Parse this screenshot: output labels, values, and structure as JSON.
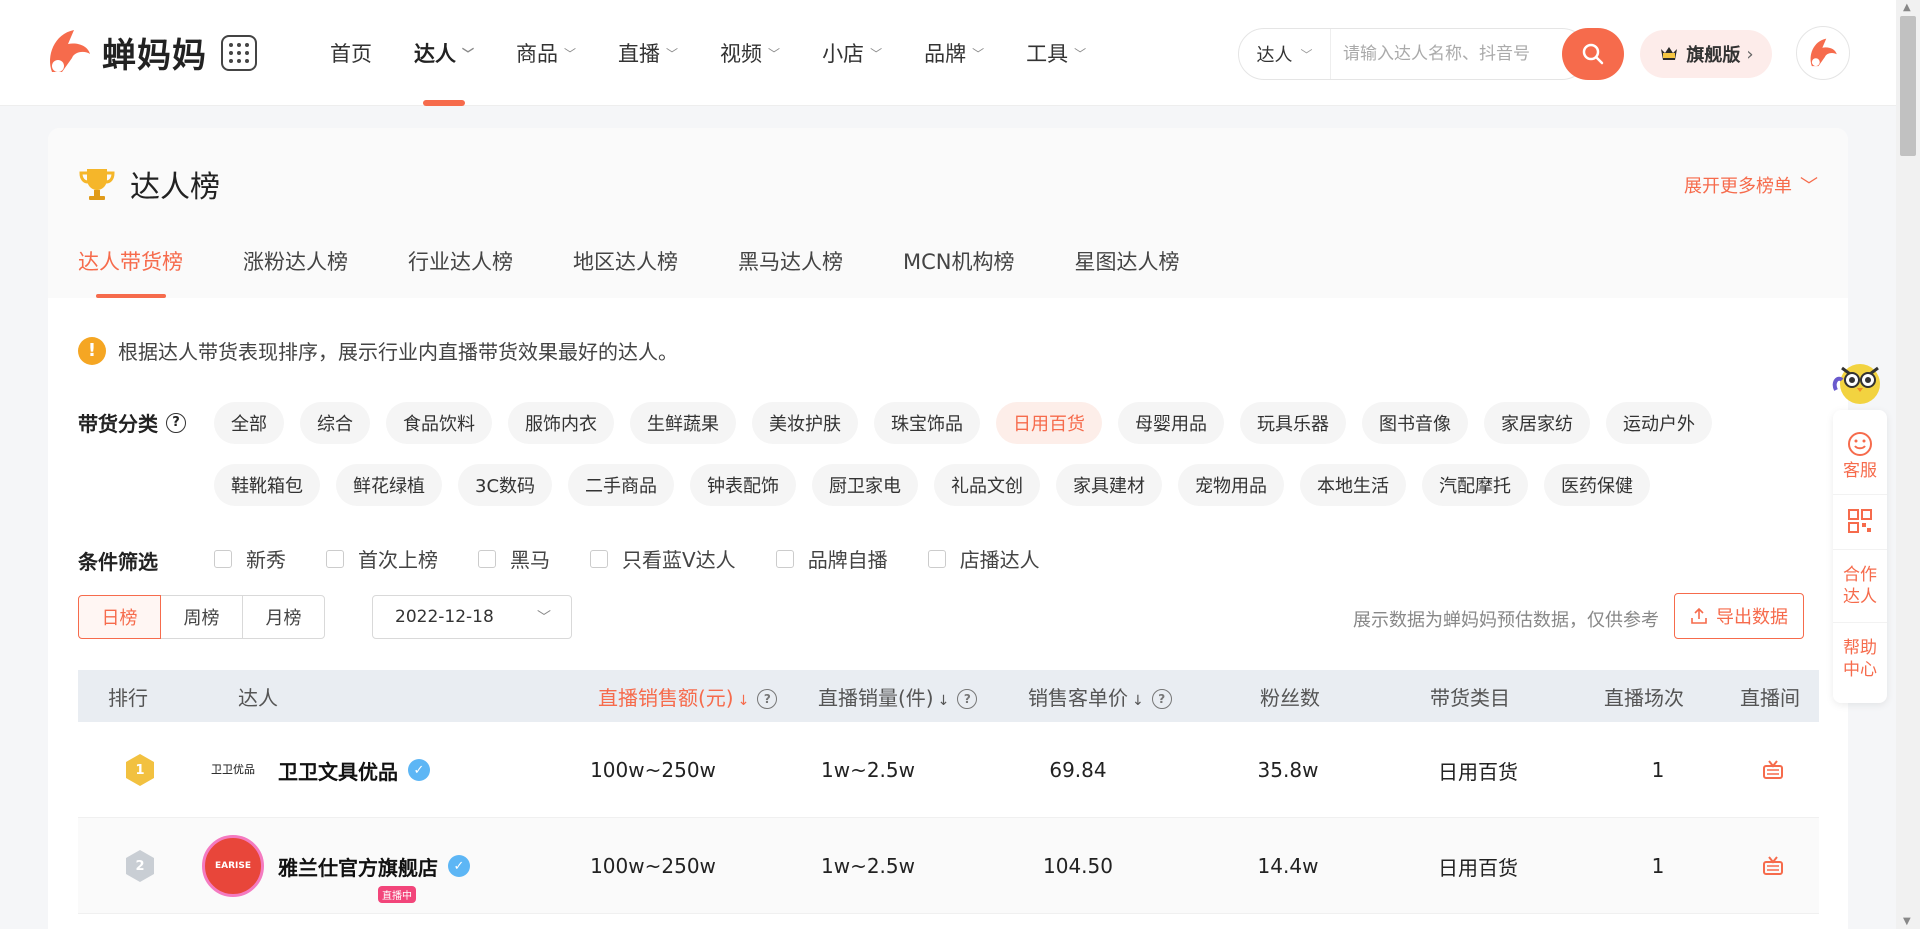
{
  "header": {
    "logo_text": "蝉妈妈",
    "nav": [
      {
        "label": "首页",
        "has_menu": false
      },
      {
        "label": "达人",
        "has_menu": true,
        "active": true
      },
      {
        "label": "商品",
        "has_menu": true
      },
      {
        "label": "直播",
        "has_menu": true
      },
      {
        "label": "视频",
        "has_menu": true
      },
      {
        "label": "小店",
        "has_menu": true
      },
      {
        "label": "品牌",
        "has_menu": true
      },
      {
        "label": "工具",
        "has_menu": true
      }
    ],
    "search": {
      "type": "达人",
      "placeholder": "请输入达人名称、抖音号"
    },
    "vip_label": "旗舰版"
  },
  "board": {
    "title": "达人榜",
    "expand_more": "展开更多榜单",
    "tabs": [
      "达人带货榜",
      "涨粉达人榜",
      "行业达人榜",
      "地区达人榜",
      "黑马达人榜",
      "MCN机构榜",
      "星图达人榜"
    ],
    "active_tab": 0,
    "notice": "根据达人带货表现排序，展示行业内直播带货效果最好的达人。",
    "category_label": "带货分类",
    "categories": [
      "全部",
      "综合",
      "食品饮料",
      "服饰内衣",
      "生鲜蔬果",
      "美妆护肤",
      "珠宝饰品",
      "日用百货",
      "母婴用品",
      "玩具乐器",
      "图书音像",
      "家居家纺",
      "运动户外",
      "鞋靴箱包",
      "鲜花绿植",
      "3C数码",
      "二手商品",
      "钟表配饰",
      "厨卫家电",
      "礼品文创",
      "家具建材",
      "宠物用品",
      "本地生活",
      "汽配摩托",
      "医药保健"
    ],
    "active_category": 7,
    "filter_label": "条件筛选",
    "filters": [
      "新秀",
      "首次上榜",
      "黑马",
      "只看蓝V达人",
      "品牌自播",
      "店播达人"
    ],
    "ranges": [
      "日榜",
      "周榜",
      "月榜"
    ],
    "active_range": 0,
    "date": "2022-12-18",
    "data_note": "展示数据为蝉妈妈预估数据，仅供参考",
    "export_label": "导出数据"
  },
  "table": {
    "headers": {
      "rank": "排行",
      "talent": "达人",
      "live_sales": "直播销售额(元)",
      "live_volume": "直播销量(件)",
      "avg_price": "销售客单价",
      "fans": "粉丝数",
      "category": "带货类目",
      "sessions": "直播场次",
      "room": "直播间"
    },
    "rows": [
      {
        "rank": "1",
        "name": "卫卫文具优品",
        "avatar_text": "卫卫优品",
        "live": false,
        "sales": "100w~250w",
        "volume": "1w~2.5w",
        "price": "69.84",
        "fans": "35.8w",
        "category": "日用百货",
        "sessions": "1"
      },
      {
        "rank": "2",
        "name": "雅兰仕官方旗舰店",
        "avatar_text": "EARISE",
        "live": true,
        "live_label": "直播中",
        "sales": "100w~250w",
        "volume": "1w~2.5w",
        "price": "104.50",
        "fans": "14.4w",
        "category": "日用百货",
        "sessions": "1"
      }
    ]
  },
  "float_panel": {
    "service": "客服",
    "partner": "合作达人",
    "help": "帮助中心"
  },
  "colors": {
    "accent": "#f66b4c",
    "verified": "#5db6f5",
    "gold": "#f2c140"
  }
}
